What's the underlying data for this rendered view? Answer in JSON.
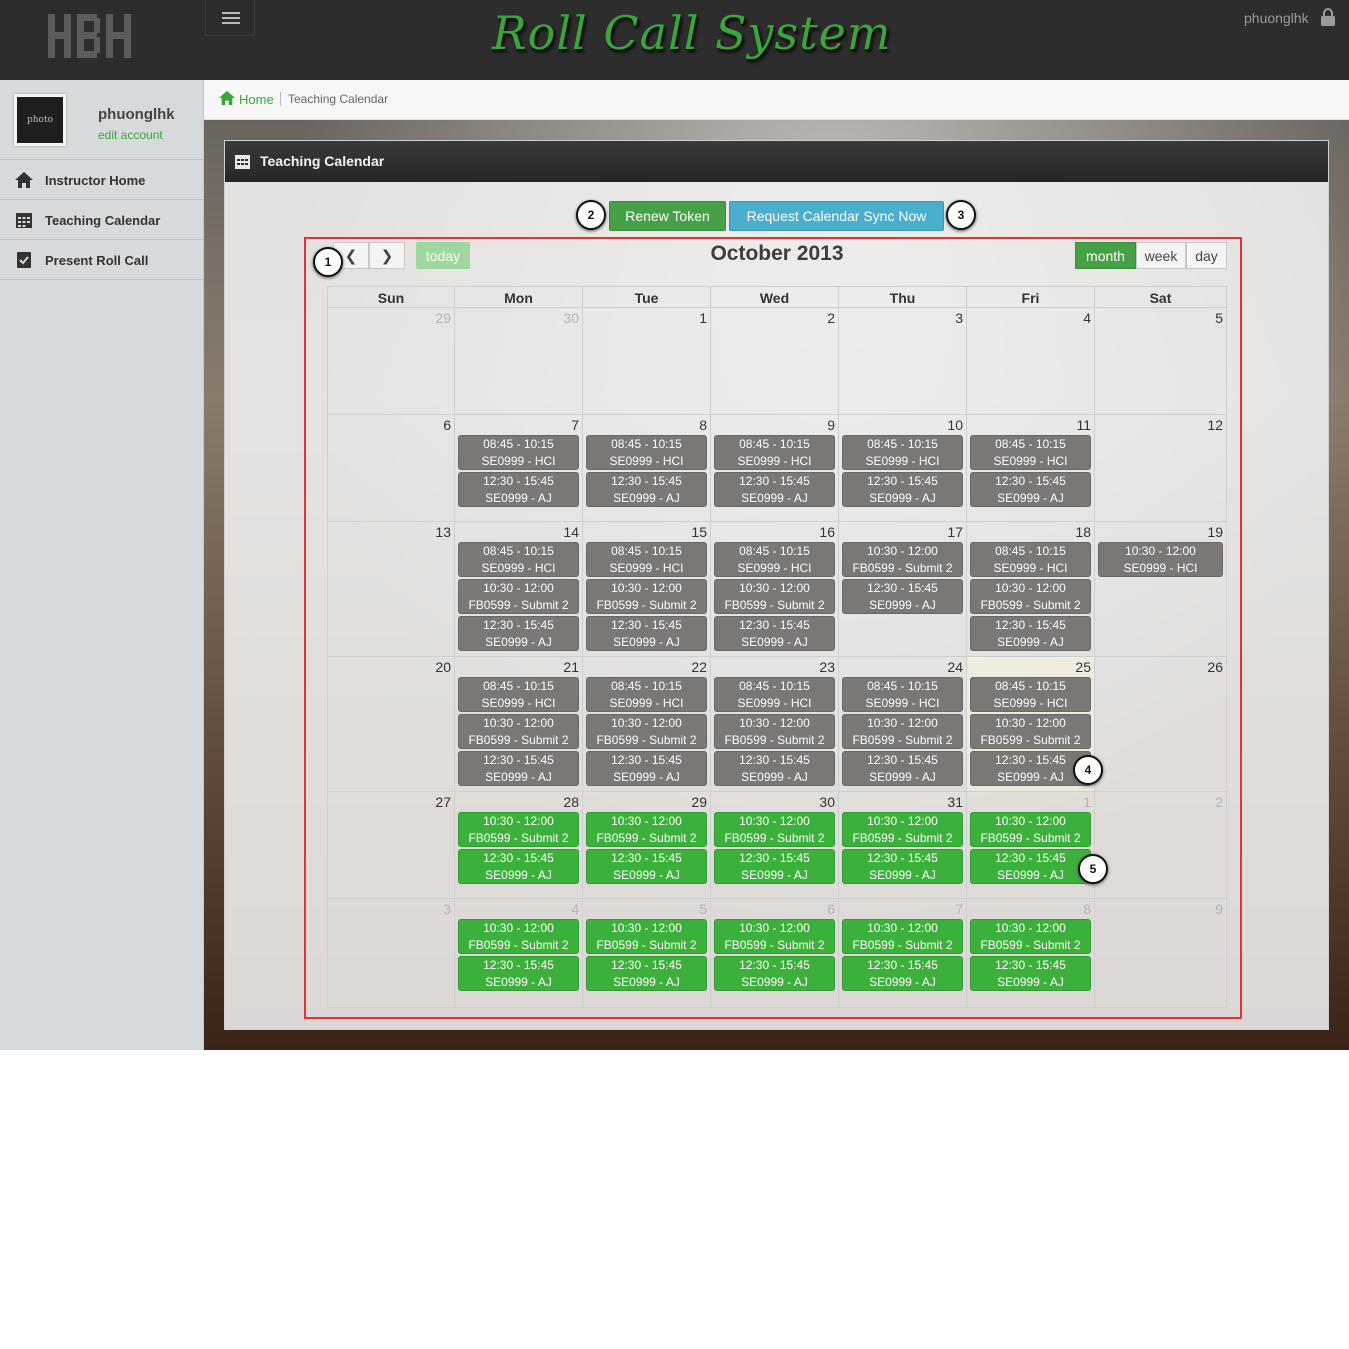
{
  "app": {
    "title": "Roll Call System",
    "logo_text": "HBH",
    "user": "phuonglhk"
  },
  "sidebar": {
    "profile": {
      "photo_label": "photo",
      "name": "phuonglhk",
      "edit_label": "edit account"
    },
    "items": [
      {
        "label": "Instructor Home",
        "icon": "home-icon"
      },
      {
        "label": "Teaching Calendar",
        "icon": "calendar-icon"
      },
      {
        "label": "Present Roll Call",
        "icon": "checklist-icon"
      }
    ]
  },
  "breadcrumb": {
    "home": "Home",
    "current": "Teaching Calendar"
  },
  "panel": {
    "title": "Teaching Calendar",
    "renew_button": "Renew Token",
    "sync_button": "Request Calendar Sync Now"
  },
  "callouts": [
    "1",
    "2",
    "3",
    "4",
    "5"
  ],
  "calendar": {
    "title": "October 2013",
    "today_label": "today",
    "prev_icon": "chevron-left-icon",
    "next_icon": "chevron-right-icon",
    "views": {
      "month": "month",
      "week": "week",
      "day": "day"
    },
    "active_view": "month",
    "day_names": [
      "Sun",
      "Mon",
      "Tue",
      "Wed",
      "Thu",
      "Fri",
      "Sat"
    ],
    "colors": {
      "past_event": "#7a7775",
      "future_event": "#3bb03b",
      "accent": "#46a146"
    },
    "weeks": [
      {
        "days": [
          {
            "n": "29",
            "other": true
          },
          {
            "n": "30",
            "other": true
          },
          {
            "n": "1"
          },
          {
            "n": "2"
          },
          {
            "n": "3"
          },
          {
            "n": "4"
          },
          {
            "n": "5"
          }
        ]
      },
      {
        "days": [
          {
            "n": "6"
          },
          {
            "n": "7",
            "events": [
              {
                "time": "08:45 - 10:15",
                "title": "SE0999 - HCI",
                "status": "past"
              },
              {
                "time": "12:30 - 15:45",
                "title": "SE0999 - AJ",
                "status": "past"
              }
            ]
          },
          {
            "n": "8",
            "events": [
              {
                "time": "08:45 - 10:15",
                "title": "SE0999 - HCI",
                "status": "past"
              },
              {
                "time": "12:30 - 15:45",
                "title": "SE0999 - AJ",
                "status": "past"
              }
            ]
          },
          {
            "n": "9",
            "events": [
              {
                "time": "08:45 - 10:15",
                "title": "SE0999 - HCI",
                "status": "past"
              },
              {
                "time": "12:30 - 15:45",
                "title": "SE0999 - AJ",
                "status": "past"
              }
            ]
          },
          {
            "n": "10",
            "events": [
              {
                "time": "08:45 - 10:15",
                "title": "SE0999 - HCI",
                "status": "past"
              },
              {
                "time": "12:30 - 15:45",
                "title": "SE0999 - AJ",
                "status": "past"
              }
            ]
          },
          {
            "n": "11",
            "events": [
              {
                "time": "08:45 - 10:15",
                "title": "SE0999 - HCI",
                "status": "past"
              },
              {
                "time": "12:30 - 15:45",
                "title": "SE0999 - AJ",
                "status": "past"
              }
            ]
          },
          {
            "n": "12"
          }
        ]
      },
      {
        "days": [
          {
            "n": "13"
          },
          {
            "n": "14",
            "events": [
              {
                "time": "08:45 - 10:15",
                "title": "SE0999 - HCI",
                "status": "past"
              },
              {
                "time": "10:30 - 12:00",
                "title": "FB0599 - Submit 2",
                "status": "past"
              },
              {
                "time": "12:30 - 15:45",
                "title": "SE0999 - AJ",
                "status": "past"
              }
            ]
          },
          {
            "n": "15",
            "events": [
              {
                "time": "08:45 - 10:15",
                "title": "SE0999 - HCI",
                "status": "past"
              },
              {
                "time": "10:30 - 12:00",
                "title": "FB0599 - Submit 2",
                "status": "past"
              },
              {
                "time": "12:30 - 15:45",
                "title": "SE0999 - AJ",
                "status": "past"
              }
            ]
          },
          {
            "n": "16",
            "events": [
              {
                "time": "08:45 - 10:15",
                "title": "SE0999 - HCI",
                "status": "past"
              },
              {
                "time": "10:30 - 12:00",
                "title": "FB0599 - Submit 2",
                "status": "past"
              },
              {
                "time": "12:30 - 15:45",
                "title": "SE0999 - AJ",
                "status": "past"
              }
            ]
          },
          {
            "n": "17",
            "events": [
              {
                "time": "10:30 - 12:00",
                "title": "FB0599 - Submit 2",
                "status": "past"
              },
              {
                "time": "12:30 - 15:45",
                "title": "SE0999 - AJ",
                "status": "past"
              }
            ]
          },
          {
            "n": "18",
            "events": [
              {
                "time": "08:45 - 10:15",
                "title": "SE0999 - HCI",
                "status": "past"
              },
              {
                "time": "10:30 - 12:00",
                "title": "FB0599 - Submit 2",
                "status": "past"
              },
              {
                "time": "12:30 - 15:45",
                "title": "SE0999 - AJ",
                "status": "past"
              }
            ]
          },
          {
            "n": "19",
            "events": [
              {
                "time": "10:30 - 12:00",
                "title": "SE0999 - HCI",
                "status": "past"
              }
            ]
          }
        ]
      },
      {
        "days": [
          {
            "n": "20"
          },
          {
            "n": "21",
            "events": [
              {
                "time": "08:45 - 10:15",
                "title": "SE0999 - HCI",
                "status": "past"
              },
              {
                "time": "10:30 - 12:00",
                "title": "FB0599 - Submit 2",
                "status": "past"
              },
              {
                "time": "12:30 - 15:45",
                "title": "SE0999 - AJ",
                "status": "past"
              }
            ]
          },
          {
            "n": "22",
            "events": [
              {
                "time": "08:45 - 10:15",
                "title": "SE0999 - HCI",
                "status": "past"
              },
              {
                "time": "10:30 - 12:00",
                "title": "FB0599 - Submit 2",
                "status": "past"
              },
              {
                "time": "12:30 - 15:45",
                "title": "SE0999 - AJ",
                "status": "past"
              }
            ]
          },
          {
            "n": "23",
            "events": [
              {
                "time": "08:45 - 10:15",
                "title": "SE0999 - HCI",
                "status": "past"
              },
              {
                "time": "10:30 - 12:00",
                "title": "FB0599 - Submit 2",
                "status": "past"
              },
              {
                "time": "12:30 - 15:45",
                "title": "SE0999 - AJ",
                "status": "past"
              }
            ]
          },
          {
            "n": "24",
            "events": [
              {
                "time": "08:45 - 10:15",
                "title": "SE0999 - HCI",
                "status": "past"
              },
              {
                "time": "10:30 - 12:00",
                "title": "FB0599 - Submit 2",
                "status": "past"
              },
              {
                "time": "12:30 - 15:45",
                "title": "SE0999 - AJ",
                "status": "past"
              }
            ]
          },
          {
            "n": "25",
            "today": true,
            "events": [
              {
                "time": "08:45 - 10:15",
                "title": "SE0999 - HCI",
                "status": "past"
              },
              {
                "time": "10:30 - 12:00",
                "title": "FB0599 - Submit 2",
                "status": "past"
              },
              {
                "time": "12:30 - 15:45",
                "title": "SE0999 - AJ",
                "status": "past"
              }
            ]
          },
          {
            "n": "26"
          }
        ]
      },
      {
        "days": [
          {
            "n": "27"
          },
          {
            "n": "28",
            "events": [
              {
                "time": "10:30 - 12:00",
                "title": "FB0599 - Submit 2",
                "status": "future"
              },
              {
                "time": "12:30 - 15:45",
                "title": "SE0999 - AJ",
                "status": "future"
              }
            ]
          },
          {
            "n": "29",
            "events": [
              {
                "time": "10:30 - 12:00",
                "title": "FB0599 - Submit 2",
                "status": "future"
              },
              {
                "time": "12:30 - 15:45",
                "title": "SE0999 - AJ",
                "status": "future"
              }
            ]
          },
          {
            "n": "30",
            "events": [
              {
                "time": "10:30 - 12:00",
                "title": "FB0599 - Submit 2",
                "status": "future"
              },
              {
                "time": "12:30 - 15:45",
                "title": "SE0999 - AJ",
                "status": "future"
              }
            ]
          },
          {
            "n": "31",
            "events": [
              {
                "time": "10:30 - 12:00",
                "title": "FB0599 - Submit 2",
                "status": "future"
              },
              {
                "time": "12:30 - 15:45",
                "title": "SE0999 - AJ",
                "status": "future"
              }
            ]
          },
          {
            "n": "1",
            "other": true,
            "events": [
              {
                "time": "10:30 - 12:00",
                "title": "FB0599 - Submit 2",
                "status": "future"
              },
              {
                "time": "12:30 - 15:45",
                "title": "SE0999 - AJ",
                "status": "future"
              }
            ]
          },
          {
            "n": "2",
            "other": true
          }
        ]
      },
      {
        "days": [
          {
            "n": "3",
            "other": true
          },
          {
            "n": "4",
            "other": true,
            "events": [
              {
                "time": "10:30 - 12:00",
                "title": "FB0599 - Submit 2",
                "status": "future"
              },
              {
                "time": "12:30 - 15:45",
                "title": "SE0999 - AJ",
                "status": "future"
              }
            ]
          },
          {
            "n": "5",
            "other": true,
            "events": [
              {
                "time": "10:30 - 12:00",
                "title": "FB0599 - Submit 2",
                "status": "future"
              },
              {
                "time": "12:30 - 15:45",
                "title": "SE0999 - AJ",
                "status": "future"
              }
            ]
          },
          {
            "n": "6",
            "other": true,
            "events": [
              {
                "time": "10:30 - 12:00",
                "title": "FB0599 - Submit 2",
                "status": "future"
              },
              {
                "time": "12:30 - 15:45",
                "title": "SE0999 - AJ",
                "status": "future"
              }
            ]
          },
          {
            "n": "7",
            "other": true,
            "events": [
              {
                "time": "10:30 - 12:00",
                "title": "FB0599 - Submit 2",
                "status": "future"
              },
              {
                "time": "12:30 - 15:45",
                "title": "SE0999 - AJ",
                "status": "future"
              }
            ]
          },
          {
            "n": "8",
            "other": true,
            "events": [
              {
                "time": "10:30 - 12:00",
                "title": "FB0599 - Submit 2",
                "status": "future"
              },
              {
                "time": "12:30 - 15:45",
                "title": "SE0999 - AJ",
                "status": "future"
              }
            ]
          },
          {
            "n": "9",
            "other": true
          }
        ]
      }
    ]
  }
}
